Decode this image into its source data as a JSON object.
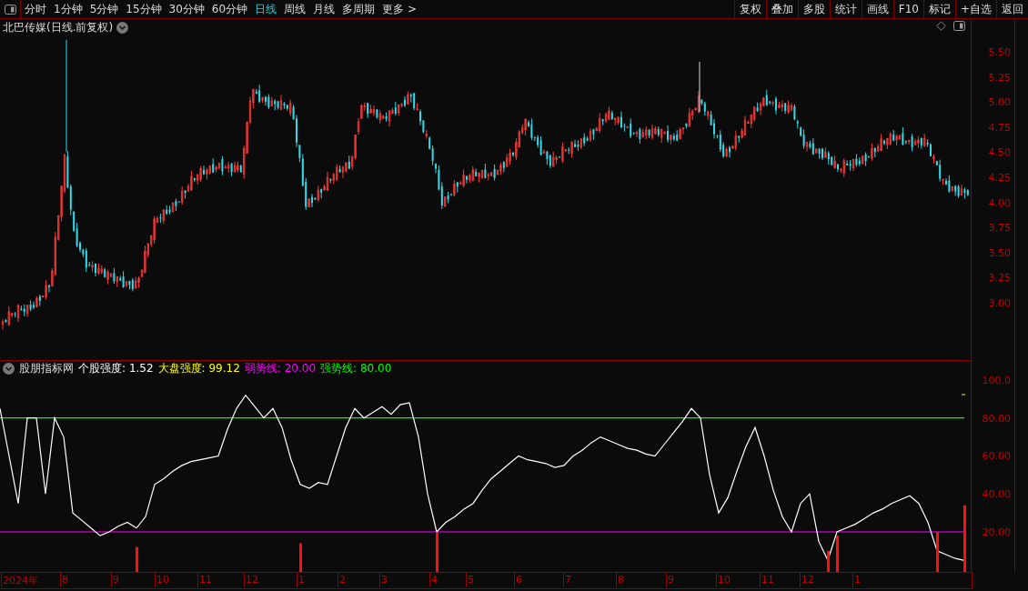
{
  "toolbar": {
    "periods": [
      {
        "label": "分时",
        "selected": false
      },
      {
        "label": "1分钟",
        "selected": false
      },
      {
        "label": "5分钟",
        "selected": false
      },
      {
        "label": "15分钟",
        "selected": false
      },
      {
        "label": "30分钟",
        "selected": false
      },
      {
        "label": "60分钟",
        "selected": false
      },
      {
        "label": "日线",
        "selected": true
      },
      {
        "label": "周线",
        "selected": false
      },
      {
        "label": "月线",
        "selected": false
      },
      {
        "label": "多周期",
        "selected": false
      },
      {
        "label": "更多 >",
        "selected": false
      }
    ],
    "buttons": [
      "复权",
      "叠加",
      "多股",
      "统计",
      "画线",
      "F10",
      "标记",
      "+自选",
      "返回"
    ]
  },
  "price_panel": {
    "title": "北巴传媒(日线.前复权)",
    "axis_ticks": [
      "5.50",
      "5.25",
      "5.00",
      "4.75",
      "4.50",
      "4.25",
      "4.00",
      "3.75",
      "3.50",
      "3.25",
      "3.00"
    ]
  },
  "indicator_panel": {
    "name": "股朋指标网",
    "items": [
      {
        "label": "个股强度:",
        "value": "1.52",
        "color": "#ffffff"
      },
      {
        "label": "大盘强度:",
        "value": "99.12",
        "color": "#ffff00"
      },
      {
        "label": "弱势线:",
        "value": "20.00",
        "color": "#ff00ff"
      },
      {
        "label": "强势线:",
        "value": "80.00",
        "color": "#00ff00"
      }
    ],
    "chart_data": {
      "type": "line",
      "ylim": [
        -1,
        100
      ],
      "yticks": [
        {
          "value": 100,
          "label": "100.0"
        },
        {
          "value": 80,
          "label": "80.00"
        },
        {
          "value": 60,
          "label": "60.00"
        },
        {
          "value": 40,
          "label": "40.00"
        },
        {
          "value": 20,
          "label": "20.00"
        }
      ],
      "series": [
        {
          "color": "#00ff00",
          "values": [
            80,
            80,
            80,
            80,
            80,
            80,
            80,
            80,
            80,
            80,
            80,
            80,
            80,
            80,
            80,
            80,
            80,
            80,
            80,
            80,
            80,
            80,
            80,
            80,
            80,
            80,
            80,
            80,
            80,
            80,
            80,
            80,
            80,
            80,
            80,
            80,
            80,
            80,
            80,
            80,
            80,
            80,
            80,
            80,
            80,
            80,
            80,
            80,
            80,
            80,
            80,
            80,
            80,
            80,
            80,
            80,
            80,
            80,
            80,
            80,
            80,
            80,
            80,
            80,
            80,
            80,
            80,
            80,
            80,
            80,
            80,
            80,
            80,
            80,
            80,
            80,
            80,
            80,
            80,
            80,
            80,
            80,
            80,
            80,
            80,
            80,
            80,
            80,
            80,
            80,
            80,
            80,
            80,
            80,
            80,
            80,
            80,
            80,
            80,
            80,
            80,
            80,
            80,
            80,
            80,
            80,
            80
          ]
        },
        {
          "color": "#ff00ff",
          "values": [
            20,
            20,
            20,
            20,
            20,
            20,
            20,
            20,
            20,
            20,
            20,
            20,
            20,
            20,
            20,
            20,
            20,
            20,
            20,
            20,
            20,
            20,
            20,
            20,
            20,
            20,
            20,
            20,
            20,
            20,
            20,
            20,
            20,
            20,
            20,
            20,
            20,
            20,
            20,
            20,
            20,
            20,
            20,
            20,
            20,
            20,
            20,
            20,
            20,
            20,
            20,
            20,
            20,
            20,
            20,
            20,
            20,
            20,
            20,
            20,
            20,
            20,
            20,
            20,
            20,
            20,
            20,
            20,
            20,
            20,
            20,
            20,
            20,
            20,
            20,
            20,
            20,
            20,
            20,
            20,
            20,
            20,
            20,
            20,
            20,
            20,
            20,
            20,
            20,
            20,
            20,
            20,
            20,
            20,
            20,
            20,
            20,
            20,
            20,
            20,
            20,
            20,
            20,
            20,
            20,
            20,
            20
          ]
        },
        {
          "color": "#ffffff",
          "values": [
            85,
            60,
            35,
            80,
            80,
            40,
            80,
            70,
            30,
            26,
            22,
            18,
            20,
            23,
            25,
            22,
            28,
            45,
            48,
            52,
            55,
            57,
            58,
            59,
            60,
            74,
            85,
            92,
            86,
            80,
            85,
            75,
            58,
            45,
            43,
            46,
            45,
            60,
            75,
            85,
            80,
            83,
            86,
            82,
            87,
            88,
            70,
            40,
            20,
            25,
            28,
            32,
            35,
            42,
            48,
            52,
            56,
            60,
            58,
            57,
            56,
            54,
            55,
            60,
            63,
            67,
            70,
            68,
            66,
            64,
            63,
            61,
            60,
            66,
            72,
            78,
            85,
            80,
            50,
            30,
            38,
            52,
            65,
            75,
            60,
            42,
            28,
            20,
            35,
            40,
            15,
            5,
            20,
            22,
            24,
            27,
            30,
            32,
            35,
            37,
            39,
            35,
            25,
            10,
            8,
            6,
            5
          ]
        },
        {
          "type": "bar",
          "color": "#ff1010",
          "values": [
            null,
            null,
            null,
            null,
            null,
            null,
            null,
            null,
            null,
            null,
            null,
            null,
            null,
            null,
            null,
            12,
            null,
            null,
            null,
            null,
            null,
            null,
            null,
            null,
            null,
            null,
            null,
            null,
            null,
            null,
            null,
            null,
            null,
            14,
            null,
            null,
            null,
            null,
            null,
            null,
            null,
            null,
            null,
            null,
            null,
            null,
            null,
            null,
            20,
            null,
            null,
            null,
            null,
            null,
            null,
            null,
            null,
            null,
            null,
            null,
            null,
            null,
            null,
            null,
            null,
            null,
            null,
            null,
            null,
            null,
            null,
            null,
            null,
            null,
            null,
            null,
            null,
            null,
            null,
            null,
            null,
            null,
            null,
            null,
            null,
            null,
            null,
            null,
            null,
            null,
            null,
            10,
            18,
            null,
            null,
            null,
            null,
            null,
            null,
            null,
            null,
            null,
            null,
            20,
            null,
            null,
            34
          ]
        }
      ]
    }
  },
  "x_axis": {
    "labels": [
      "2024年",
      "8",
      "9",
      "10",
      "11",
      "12",
      "1",
      "2",
      "3",
      "4",
      "5",
      "6",
      "7",
      "8",
      "9",
      "10",
      "11",
      "12",
      "1"
    ]
  }
}
